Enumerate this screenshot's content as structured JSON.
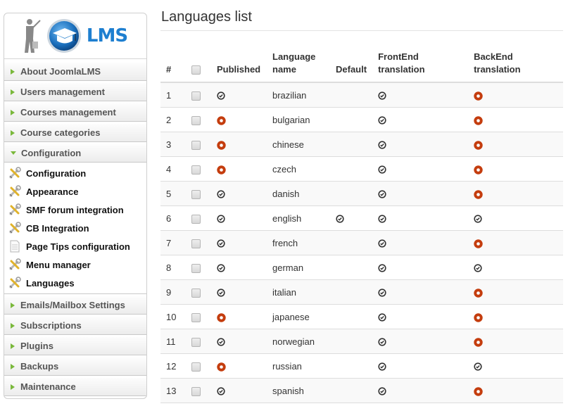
{
  "sidebar": {
    "logo_text": "LMS",
    "sections_top": [
      {
        "label": "About JoomlaLMS"
      },
      {
        "label": "Users management"
      },
      {
        "label": "Courses management"
      },
      {
        "label": "Course categories"
      }
    ],
    "open_section": {
      "label": "Configuration",
      "items": [
        {
          "label": "Configuration",
          "icon": "tools-icon"
        },
        {
          "label": "Appearance",
          "icon": "tools-icon"
        },
        {
          "label": "SMF forum integration",
          "icon": "tools-icon"
        },
        {
          "label": "CB Integration",
          "icon": "tools-icon"
        },
        {
          "label": "Page Tips configuration",
          "icon": "document-icon"
        },
        {
          "label": "Menu manager",
          "icon": "tools-icon"
        },
        {
          "label": "Languages",
          "icon": "tools-icon"
        }
      ]
    },
    "sections_bottom": [
      {
        "label": "Emails/Mailbox Settings"
      },
      {
        "label": "Subscriptions"
      },
      {
        "label": "Plugins"
      },
      {
        "label": "Backups"
      },
      {
        "label": "Maintenance"
      }
    ]
  },
  "main": {
    "title": "Languages list",
    "columns": {
      "num": "#",
      "published": "Published",
      "name_line1": "Language",
      "name_line2": "name",
      "default": "Default",
      "frontend_line1": "FrontEnd",
      "frontend_line2": "translation",
      "backend_line1": "BackEnd",
      "backend_line2": "translation"
    },
    "rows": [
      {
        "num": "1",
        "name": "brazilian",
        "published": true,
        "default": false,
        "frontend": true,
        "backend": false
      },
      {
        "num": "2",
        "name": "bulgarian",
        "published": false,
        "default": false,
        "frontend": true,
        "backend": false
      },
      {
        "num": "3",
        "name": "chinese",
        "published": false,
        "default": false,
        "frontend": true,
        "backend": false
      },
      {
        "num": "4",
        "name": "czech",
        "published": false,
        "default": false,
        "frontend": true,
        "backend": false
      },
      {
        "num": "5",
        "name": "danish",
        "published": true,
        "default": false,
        "frontend": true,
        "backend": false
      },
      {
        "num": "6",
        "name": "english",
        "published": true,
        "default": true,
        "frontend": true,
        "backend": true
      },
      {
        "num": "7",
        "name": "french",
        "published": true,
        "default": false,
        "frontend": true,
        "backend": false
      },
      {
        "num": "8",
        "name": "german",
        "published": true,
        "default": false,
        "frontend": true,
        "backend": true
      },
      {
        "num": "9",
        "name": "italian",
        "published": true,
        "default": false,
        "frontend": true,
        "backend": false
      },
      {
        "num": "10",
        "name": "japanese",
        "published": false,
        "default": false,
        "frontend": true,
        "backend": false
      },
      {
        "num": "11",
        "name": "norwegian",
        "published": true,
        "default": false,
        "frontend": true,
        "backend": false
      },
      {
        "num": "12",
        "name": "russian",
        "published": false,
        "default": false,
        "frontend": true,
        "backend": true
      },
      {
        "num": "13",
        "name": "spanish",
        "published": true,
        "default": false,
        "frontend": true,
        "backend": false
      }
    ]
  },
  "colors": {
    "check": "#333333",
    "unpublished": "#c43d0e",
    "arrow": "#7ab83b",
    "logo_blue": "#1e7fd0"
  }
}
